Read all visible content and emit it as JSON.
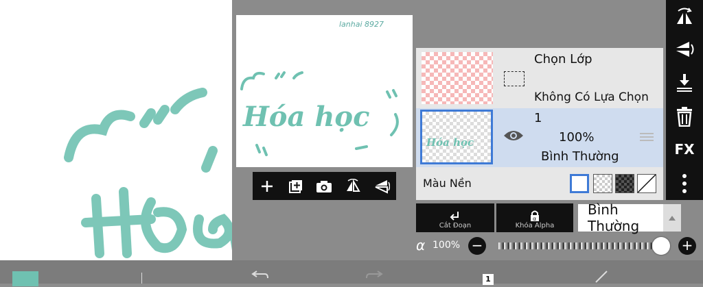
{
  "preview": {
    "watermark": "lanhai 8927",
    "art_text": "Hóa học"
  },
  "preview_tools": [
    {
      "name": "add-layer-icon",
      "glyph": "+"
    },
    {
      "name": "add-copy-icon",
      "glyph": "⊞"
    },
    {
      "name": "camera-icon",
      "glyph": ""
    },
    {
      "name": "flip-horizontal-icon",
      "glyph": ""
    },
    {
      "name": "flip-vertical-icon",
      "glyph": ""
    }
  ],
  "selection_layer": {
    "title": "Chọn Lớp",
    "subtitle": "Không Có Lựa Chọn"
  },
  "layer": {
    "name": "1",
    "opacity": "100%",
    "blend_mode": "Bình Thường"
  },
  "background_row": {
    "label": "Màu Nền"
  },
  "buttons": {
    "clipping": "Cắt Đoạn",
    "alpha_lock": "Khóa Alpha"
  },
  "blend_select": {
    "value": "Bình Thường"
  },
  "alpha": {
    "symbol": "α",
    "value": "100%",
    "fraction": 1.0
  },
  "right_toolbar": {
    "fx_label": "FX"
  },
  "bottom_bar": {
    "layer_count": "1"
  },
  "colors": {
    "accent": "#3e7ad6",
    "brush": "#6fc1b1",
    "selection_checker": "#f6b8b8"
  }
}
